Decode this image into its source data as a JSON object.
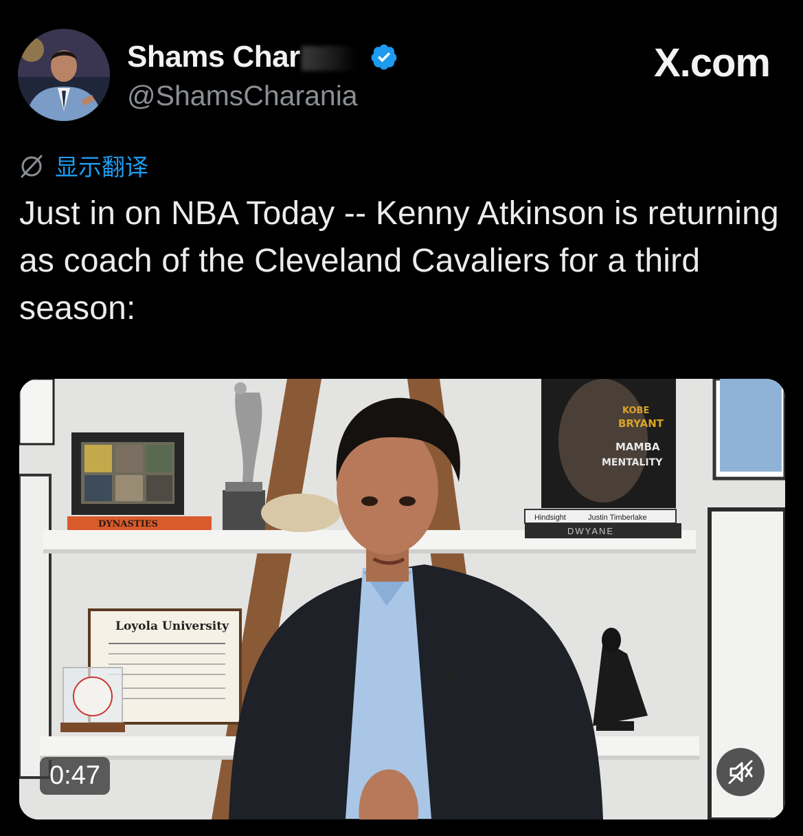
{
  "author": {
    "display_name": "Shams Char",
    "handle": "@ShamsCharania",
    "verified": true,
    "avatar_icon": "avatar-photo"
  },
  "brand": {
    "label": "X.com"
  },
  "translate": {
    "label": "显示翻译",
    "icon": "globe-slash-icon",
    "color": "#1d9bf0"
  },
  "tweet": {
    "text": "Just in on NBA Today -- Kenny Atkinson is returning as coach of the Cleveland Cavaliers for a third season:"
  },
  "media": {
    "type": "video",
    "duration": "0:47",
    "muted": true,
    "scene_text": {
      "book_spine_1": "DYNASTIES",
      "diploma_title": "Loyola University",
      "book_title_1": "KOBE",
      "book_title_2": "BRYANT",
      "book_title_3": "MAMBA",
      "book_title_4": "MENTALITY",
      "book_spine_2": "Hindsight",
      "book_spine_3": "Justin Timberlake",
      "book_spine_4": "DWYANE"
    }
  }
}
